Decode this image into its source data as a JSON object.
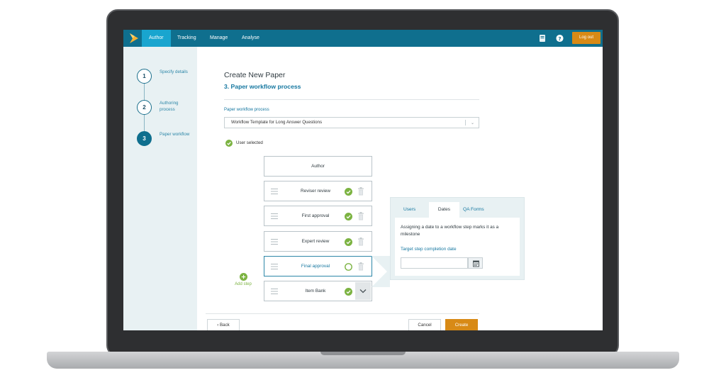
{
  "topbar": {
    "tabs": [
      {
        "label": "Author",
        "active": true
      },
      {
        "label": "Tracking",
        "active": false
      },
      {
        "label": "Manage",
        "active": false
      },
      {
        "label": "Analyse",
        "active": false
      }
    ],
    "logout_label": "Log out",
    "icons": [
      "book-icon",
      "help-icon"
    ],
    "accent_color": "#19a5cf",
    "bar_color": "#0f6f8e"
  },
  "sidebar": {
    "steps": [
      {
        "number": "1",
        "label": "Specify details",
        "current": false
      },
      {
        "number": "2",
        "label": "Authoring process",
        "current": false
      },
      {
        "number": "3",
        "label": "Paper workflow",
        "current": true
      }
    ]
  },
  "page": {
    "title": "Create New Paper",
    "subtitle": "3. Paper workflow process"
  },
  "workflow_select": {
    "label": "Paper workflow process",
    "value": "Workflow Template for Long Answer Questions"
  },
  "user_selected_text": "User selected",
  "workflow": {
    "author_label": "Author",
    "steps": [
      {
        "label": "Reviser review",
        "status": "complete"
      },
      {
        "label": "First approval",
        "status": "complete"
      },
      {
        "label": "Expert review",
        "status": "complete"
      },
      {
        "label": "Final approval",
        "status": "incomplete"
      },
      {
        "label": "Item Bank",
        "status": "complete"
      }
    ],
    "add_step_label": "Add step"
  },
  "popover": {
    "tabs": [
      {
        "label": "Users",
        "active": false
      },
      {
        "label": "Dates",
        "active": true
      },
      {
        "label": "QA Forms",
        "active": false
      }
    ],
    "description": "Assigning a date to a workflow step marks it as a milestone",
    "field_label": "Target step completion date",
    "date_value": ""
  },
  "footer": {
    "back_label": "Back",
    "cancel_label": "Cancel",
    "create_label": "Create"
  },
  "colors": {
    "create_button": "#d88a16",
    "status_complete": "#7cb342",
    "link": "#1577a0"
  }
}
